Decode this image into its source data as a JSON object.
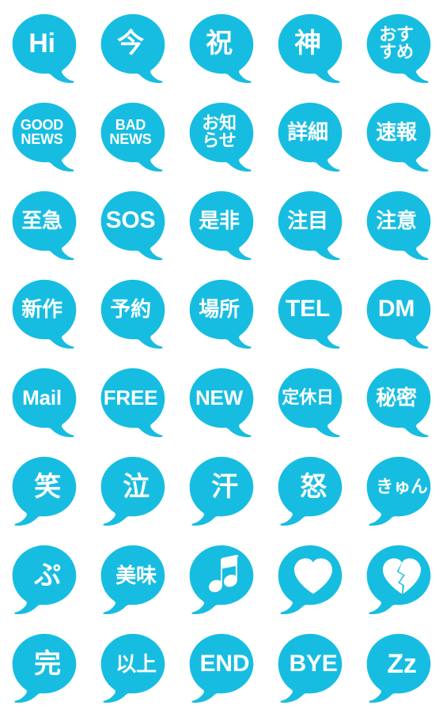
{
  "sheet": {
    "title": "Blue speech bubble emoji sticker sheet",
    "columns": 5,
    "rows": 8,
    "bubble_color": "#17bde1",
    "text_color": "#ffffff",
    "background_color": "#ffffff"
  },
  "stickers": [
    {
      "id": "hi",
      "text": "Hi",
      "size": "sz-xl",
      "tail": "right",
      "kind": "text"
    },
    {
      "id": "ima",
      "text": "今",
      "size": "sz-xl",
      "tail": "right",
      "kind": "text"
    },
    {
      "id": "iwai",
      "text": "祝",
      "size": "sz-xl",
      "tail": "right",
      "kind": "text"
    },
    {
      "id": "kami",
      "text": "神",
      "size": "sz-xl",
      "tail": "right",
      "kind": "text"
    },
    {
      "id": "osusume",
      "text": "おす\nすめ",
      "size": "sz-sm",
      "tail": "right",
      "kind": "text"
    },
    {
      "id": "good-news",
      "text": "GOOD\nNEWS",
      "size": "sz-xs",
      "tail": "right",
      "kind": "text"
    },
    {
      "id": "bad-news",
      "text": "BAD\nNEWS",
      "size": "sz-xs",
      "tail": "right",
      "kind": "text"
    },
    {
      "id": "oshirase",
      "text": "お知\nらせ",
      "size": "sz-sm",
      "tail": "right",
      "kind": "text"
    },
    {
      "id": "shousai",
      "text": "詳細",
      "size": "sz-md",
      "tail": "right",
      "kind": "text"
    },
    {
      "id": "sokuhou",
      "text": "速報",
      "size": "sz-md",
      "tail": "right",
      "kind": "text"
    },
    {
      "id": "shikyuu",
      "text": "至急",
      "size": "sz-md",
      "tail": "right",
      "kind": "text"
    },
    {
      "id": "sos",
      "text": "SOS",
      "size": "sz-lg",
      "tail": "right",
      "kind": "text"
    },
    {
      "id": "zehi",
      "text": "是非",
      "size": "sz-md",
      "tail": "right",
      "kind": "text"
    },
    {
      "id": "chuumoku",
      "text": "注目",
      "size": "sz-md",
      "tail": "right",
      "kind": "text"
    },
    {
      "id": "chuui",
      "text": "注意",
      "size": "sz-md",
      "tail": "right",
      "kind": "text"
    },
    {
      "id": "shinsaku",
      "text": "新作",
      "size": "sz-md",
      "tail": "right",
      "kind": "text"
    },
    {
      "id": "yoyaku",
      "text": "予約",
      "size": "sz-md",
      "tail": "right",
      "kind": "text"
    },
    {
      "id": "basho",
      "text": "場所",
      "size": "sz-md",
      "tail": "right",
      "kind": "text"
    },
    {
      "id": "tel",
      "text": "TEL",
      "size": "sz-lg",
      "tail": "right",
      "kind": "text"
    },
    {
      "id": "dm",
      "text": "DM",
      "size": "sz-lg",
      "tail": "right",
      "kind": "text"
    },
    {
      "id": "mail",
      "text": "Mail",
      "size": "sz-md",
      "tail": "right",
      "kind": "text"
    },
    {
      "id": "free",
      "text": "FREE",
      "size": "sz-md",
      "tail": "right",
      "kind": "text"
    },
    {
      "id": "new",
      "text": "NEW",
      "size": "sz-md",
      "tail": "right",
      "kind": "text"
    },
    {
      "id": "teikyuubi",
      "text": "定休日",
      "size": "sz-sm",
      "tail": "right",
      "kind": "text"
    },
    {
      "id": "himitsu",
      "text": "秘密",
      "size": "sz-md",
      "tail": "right",
      "kind": "text"
    },
    {
      "id": "warai",
      "text": "笑",
      "size": "sz-xl",
      "tail": "left",
      "kind": "text"
    },
    {
      "id": "naki",
      "text": "泣",
      "size": "sz-xl",
      "tail": "left",
      "kind": "text"
    },
    {
      "id": "ase",
      "text": "汗",
      "size": "sz-xl",
      "tail": "left",
      "kind": "text"
    },
    {
      "id": "ikari",
      "text": "怒",
      "size": "sz-xl",
      "tail": "left",
      "kind": "text"
    },
    {
      "id": "kyun",
      "text": "きゅん",
      "size": "sz-sm",
      "tail": "left",
      "kind": "text"
    },
    {
      "id": "pu",
      "text": "ぷ",
      "size": "sz-xl",
      "tail": "left",
      "kind": "text"
    },
    {
      "id": "oishii",
      "text": "美味",
      "size": "sz-md",
      "tail": "left",
      "kind": "text"
    },
    {
      "id": "music",
      "text": "♪",
      "size": "sz-xl",
      "tail": "left",
      "kind": "icon",
      "icon": "music-note-icon"
    },
    {
      "id": "heart",
      "text": "♥",
      "size": "sz-xl",
      "tail": "left",
      "kind": "icon",
      "icon": "heart-icon"
    },
    {
      "id": "broken",
      "text": "💔",
      "size": "sz-xl",
      "tail": "left",
      "kind": "icon",
      "icon": "broken-heart-icon"
    },
    {
      "id": "kan",
      "text": "完",
      "size": "sz-xl",
      "tail": "left",
      "kind": "text"
    },
    {
      "id": "ijou",
      "text": "以上",
      "size": "sz-md",
      "tail": "left",
      "kind": "text"
    },
    {
      "id": "end",
      "text": "END",
      "size": "sz-lg",
      "tail": "left",
      "kind": "text"
    },
    {
      "id": "bye",
      "text": "BYE",
      "size": "sz-lg",
      "tail": "left",
      "kind": "text"
    },
    {
      "id": "zz",
      "text": "Zz",
      "size": "sz-xl",
      "tail": "left",
      "kind": "text"
    }
  ]
}
